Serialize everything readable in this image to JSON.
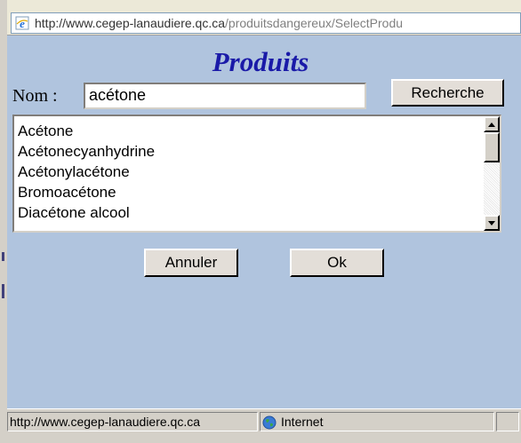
{
  "address_bar": {
    "url_host": "http://www.cegep-lanaudiere.qc.ca",
    "url_path": "/produitsdangereux/SelectProdu",
    "icon": "ie-page-icon"
  },
  "dialog": {
    "title": "Produits",
    "name_label": "Nom :",
    "name_value": "acétone",
    "search_button": "Recherche",
    "results": [
      "Acétone",
      "Acétonecyanhydrine",
      "Acétonylacétone",
      "Bromoacétone",
      "Diacétone alcool"
    ],
    "cancel_button": "Annuler",
    "ok_button": "Ok"
  },
  "statusbar": {
    "url": "http://www.cegep-lanaudiere.qc.ca",
    "zone": "Internet",
    "zone_icon": "globe-icon"
  },
  "colors": {
    "background": "#b0c4de",
    "title": "#1a1aa8",
    "button_face": "#e3ded8"
  }
}
